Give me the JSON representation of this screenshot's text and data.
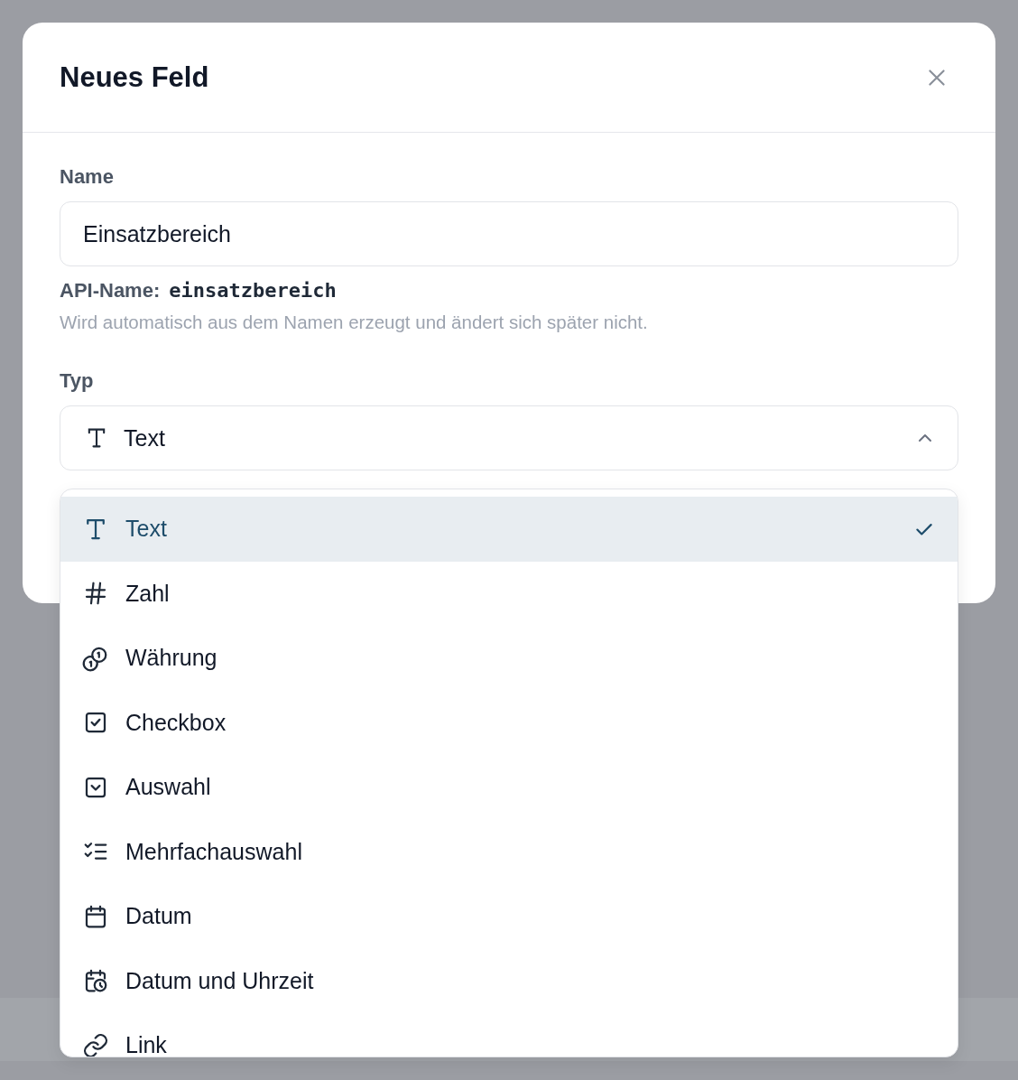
{
  "dialog": {
    "title": "Neues Feld",
    "name_field": {
      "label": "Name",
      "value": "Einsatzbereich"
    },
    "api_name": {
      "label": "API-Name:",
      "value": "einsatzbereich"
    },
    "hint": "Wird automatisch aus dem Namen erzeugt und ändert sich später nicht.",
    "type_field": {
      "label": "Typ",
      "value": "Text",
      "kind": "text",
      "expanded": true
    },
    "type_options": [
      {
        "label": "Text",
        "kind": "text",
        "selected": true
      },
      {
        "label": "Zahl",
        "kind": "number",
        "selected": false
      },
      {
        "label": "Währung",
        "kind": "currency",
        "selected": false
      },
      {
        "label": "Checkbox",
        "kind": "checkbox",
        "selected": false
      },
      {
        "label": "Auswahl",
        "kind": "select",
        "selected": false
      },
      {
        "label": "Mehrfachauswahl",
        "kind": "multiselect",
        "selected": false
      },
      {
        "label": "Datum",
        "kind": "date",
        "selected": false
      },
      {
        "label": "Datum und Uhrzeit",
        "kind": "datetime",
        "selected": false
      },
      {
        "label": "Link",
        "kind": "link",
        "selected": false
      }
    ]
  }
}
